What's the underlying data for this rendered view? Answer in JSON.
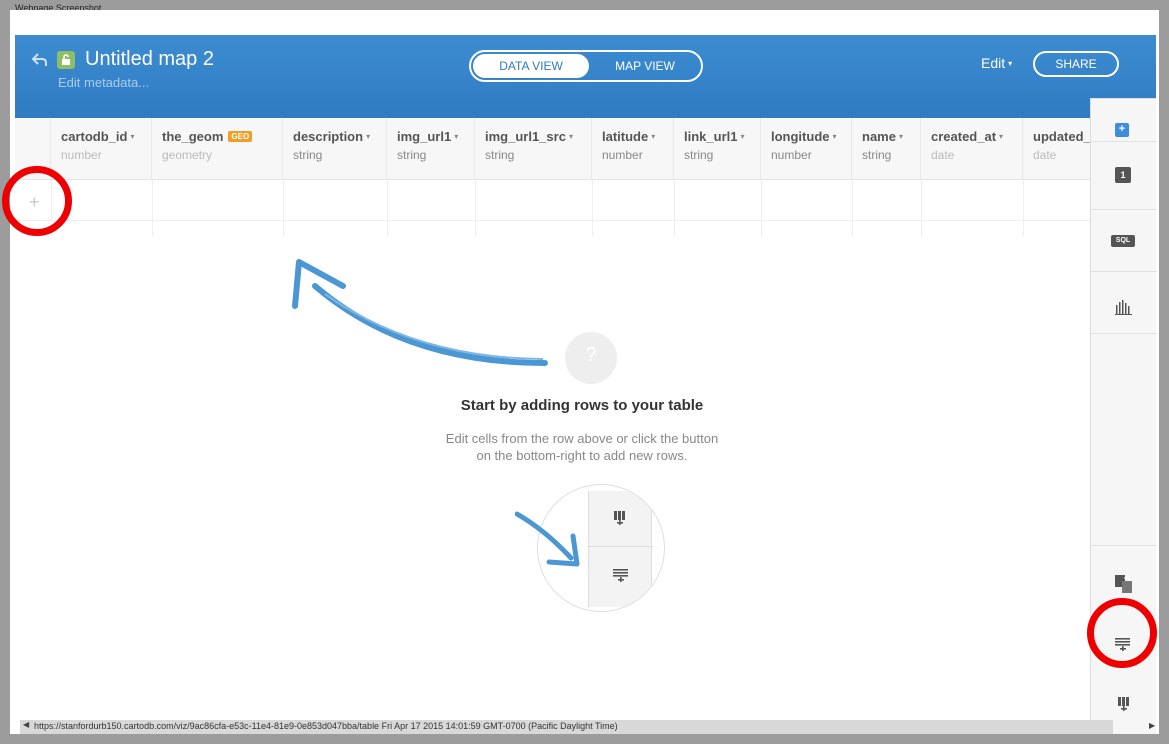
{
  "caption": "Webpage Screenshot",
  "header": {
    "title": "Untitled map 2",
    "subtitle": "Edit metadata...",
    "tabs": [
      {
        "label": "DATA VIEW",
        "active": true
      },
      {
        "label": "MAP VIEW",
        "active": false
      }
    ],
    "edit_label": "Edit",
    "share_label": "SHARE"
  },
  "table": {
    "columns": [
      {
        "name": "cartodb_id",
        "type": "number",
        "caret": "▾",
        "dim": true
      },
      {
        "name": "the_geom",
        "type": "geometry",
        "badge": "GEO",
        "dim": true
      },
      {
        "name": "description",
        "type": "string",
        "caret": "▾"
      },
      {
        "name": "img_url1",
        "type": "string",
        "caret": "▾"
      },
      {
        "name": "img_url1_src",
        "type": "string",
        "caret": "▾"
      },
      {
        "name": "latitude",
        "type": "number",
        "caret": "▾"
      },
      {
        "name": "link_url1",
        "type": "string",
        "caret": "▾"
      },
      {
        "name": "longitude",
        "type": "number",
        "caret": "▾"
      },
      {
        "name": "name",
        "type": "string",
        "caret": "▾"
      },
      {
        "name": "created_at",
        "type": "date",
        "caret": "▾",
        "dim": true
      },
      {
        "name": "updated_",
        "type": "date",
        "dim": true
      }
    ],
    "add_row_glyph": "+"
  },
  "empty_state": {
    "help_glyph": "?",
    "title": "Start by adding rows to your table",
    "desc_line1": "Edit cells from the row above or click the button",
    "desc_line2": "on the bottom-right to add new rows."
  },
  "tool_panel": {
    "add_layer_glyph": "+",
    "layer_number": "1",
    "sql_label": "SQL"
  },
  "status": {
    "url": "https://stanfordurb150.cartodb.com/viz/9ac86cfa-e53c-11e4-81e9-0e853d047bba/table Fri Apr 17 2015 14:01:59 GMT-0700 (Pacific Daylight Time)"
  },
  "colors": {
    "header_blue": "#2f7bc1",
    "highlight_red": "#ee0000",
    "geo_badge": "#f29d24",
    "lock_green": "#8ebf66",
    "arrow_blue": "#4a97d4"
  }
}
